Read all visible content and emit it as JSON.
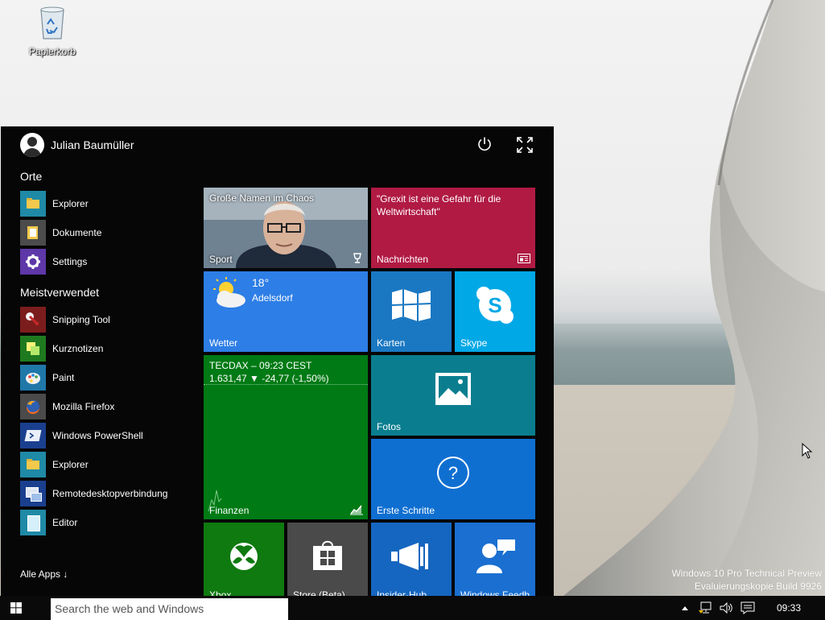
{
  "desktop": {
    "recycle_bin_label": "Papierkorb",
    "watermark": {
      "line1": "Windows 10 Pro Technical Preview",
      "line2": "Evaluierungskopie Build 9926"
    }
  },
  "start_menu": {
    "user_name": "Julian Baumüller",
    "places_heading": "Orte",
    "places": [
      {
        "label": "Explorer",
        "icon": "folder-icon"
      },
      {
        "label": "Dokumente",
        "icon": "documents-icon"
      },
      {
        "label": "Settings",
        "icon": "gear-icon"
      }
    ],
    "most_used_heading": "Meistverwendet",
    "most_used": [
      {
        "label": "Snipping Tool",
        "icon": "scissors-icon"
      },
      {
        "label": "Kurznotizen",
        "icon": "sticky-notes-icon"
      },
      {
        "label": "Paint",
        "icon": "paint-palette-icon"
      },
      {
        "label": "Mozilla Firefox",
        "icon": "firefox-icon"
      },
      {
        "label": "Windows PowerShell",
        "icon": "powershell-icon"
      },
      {
        "label": "Explorer",
        "icon": "folder-icon"
      },
      {
        "label": "Remotedesktopverbindung",
        "icon": "remote-desktop-icon"
      },
      {
        "label": "Editor",
        "icon": "notepad-icon"
      }
    ],
    "all_apps": "Alle Apps ↓",
    "tiles": {
      "sport": {
        "headline": "Große Namen im Chaos",
        "name": "Sport"
      },
      "news": {
        "headline": "\"Grexit ist eine Gefahr für die Weltwirtschaft\"",
        "name": "Nachrichten"
      },
      "weather": {
        "temp": "18°",
        "location": "Adelsdorf",
        "name": "Wetter"
      },
      "maps": {
        "name": "Karten"
      },
      "skype": {
        "name": "Skype"
      },
      "finance": {
        "line1": "TECDAX – 09:23 CEST",
        "line2": "1.631,47 ▼ -24,77 (-1,50%)",
        "name": "Finanzen"
      },
      "photos": {
        "name": "Fotos"
      },
      "getstarted": {
        "name": "Erste Schritte"
      },
      "xbox": {
        "name": "Xbox"
      },
      "store": {
        "name": "Store (Beta)"
      },
      "insider": {
        "name": "Insider-Hub"
      },
      "feedback": {
        "name": "Windows Feedb"
      }
    }
  },
  "taskbar": {
    "search_placeholder": "Search the web and Windows",
    "clock": "09:33"
  },
  "colors": {
    "news": "#b01a43",
    "weather": "#2d7ee6",
    "maps": "#1a78c2",
    "skype": "#00a8e6",
    "finance": "#007a15",
    "photos": "#0a7e8f",
    "getstarted": "#0f6fd1",
    "xbox": "#0f7a10",
    "store": "#4a4a4a",
    "insider": "#1566c0",
    "feedback": "#1a6fd1"
  }
}
